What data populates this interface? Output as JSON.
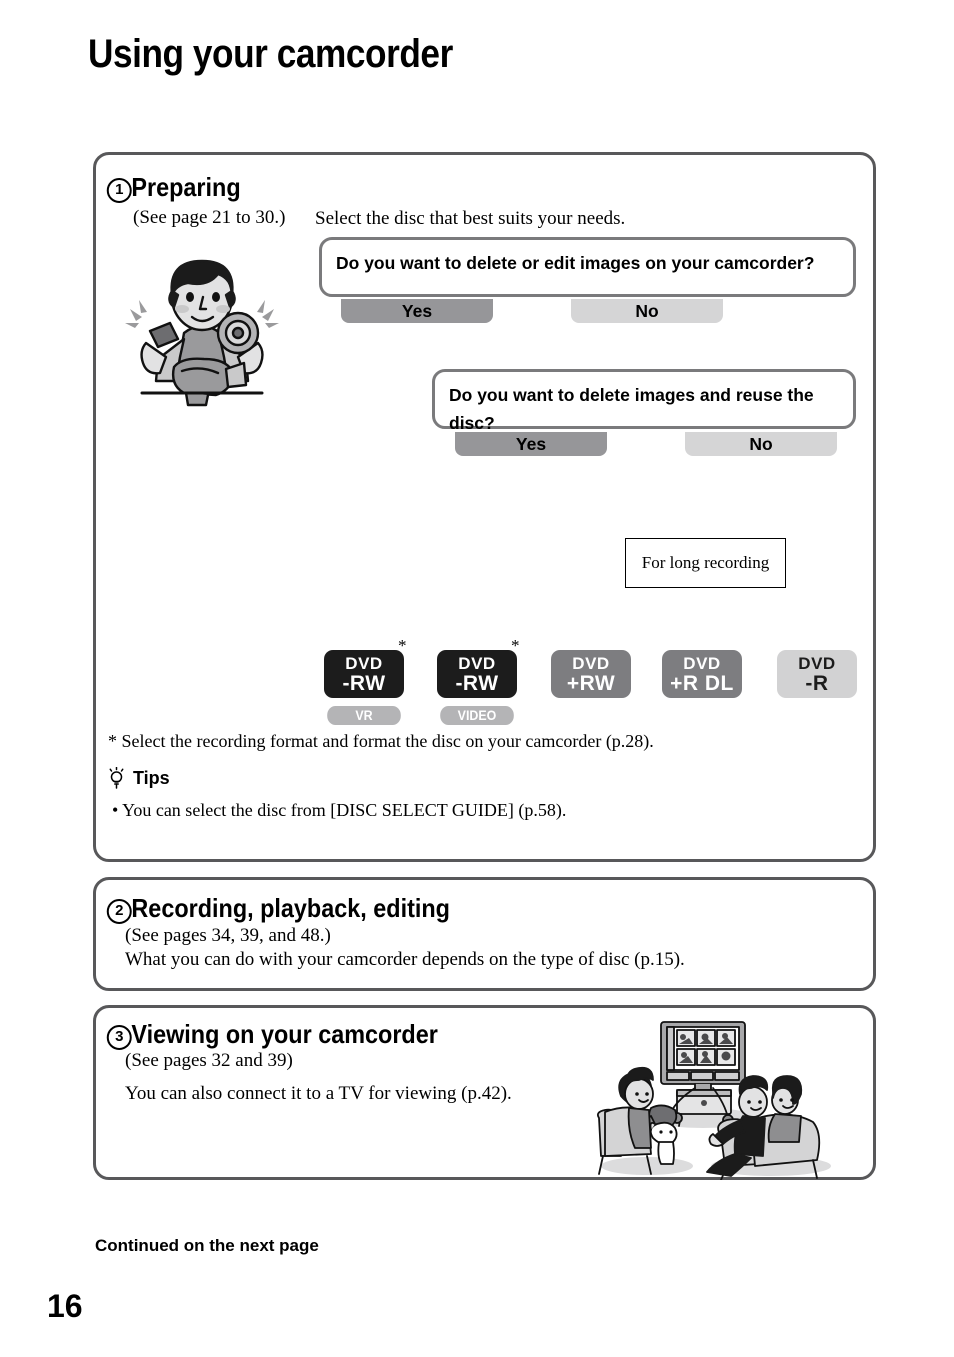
{
  "page": {
    "title": "Using your camcorder",
    "number": "16",
    "continued": "Continued on the next page"
  },
  "sections": {
    "preparing": {
      "number": "1",
      "heading": "Preparing",
      "subtitle": "(See page 21 to 30.)",
      "intro": "Select the disc that best suits your needs.",
      "footnote": "* Select the recording format and format the disc on your camcorder (p.28).",
      "tips_label": "Tips",
      "tips_icon": "lightbulb-icon",
      "tips_bullet": "• You can select the disc from [DISC SELECT GUIDE] (p.58)."
    },
    "recording": {
      "number": "2",
      "heading": "Recording, playback, editing",
      "subtitle": "(See pages 34, 39,  and 48.)",
      "body": "What you can do with your camcorder depends on the type of disc (p.15)."
    },
    "viewing": {
      "number": "3",
      "heading": "Viewing on your camcorder",
      "subtitle": "(See pages 32 and 39)",
      "body": "You can also connect it to a TV for viewing (p.42)."
    }
  },
  "flowchart": {
    "question1": "Do you want to delete or edit images on your camcorder?",
    "question2": "Do you want to delete images and reuse the disc?",
    "q1_yes": "Yes",
    "q1_no": "No",
    "q2_yes": "Yes",
    "q2_no": "No",
    "note_long_recording": "For long recording",
    "discs": [
      {
        "line1": "DVD",
        "line2": "-RW",
        "style": "black",
        "pill": "VR",
        "star": "*"
      },
      {
        "line1": "DVD",
        "line2": "-RW",
        "style": "black",
        "pill": "VIDEO",
        "star": "*"
      },
      {
        "line1": "DVD",
        "line2": "+RW",
        "style": "gray",
        "pill": "",
        "star": ""
      },
      {
        "line1": "DVD",
        "line2": "+R DL",
        "style": "gray",
        "pill": "",
        "star": ""
      },
      {
        "line1": "DVD",
        "line2": "-R",
        "style": "lgray",
        "pill": "",
        "star": ""
      }
    ]
  },
  "colors": {
    "panel_border": "#58585a",
    "arrow_dark": "#969699",
    "arrow_light": "#d5d5d6",
    "disc_black": "#1c1c1c",
    "disc_gray": "#7d7d80",
    "disc_light_gray": "#d2d2d3"
  },
  "illustrations": {
    "preparing": "person-holding-disc-and-camcorder-illustration",
    "viewing": "family-watching-tv-illustration"
  }
}
